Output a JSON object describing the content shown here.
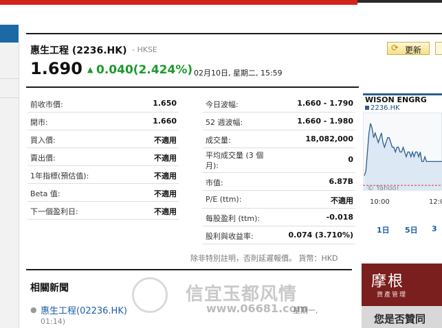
{
  "stock": {
    "name": "惠生工程 (2236.HK)",
    "exchange": "- HKSE",
    "price": "1.690",
    "change": "0.040(2.424%)",
    "timestamp": "02月10日, 星期二, 15:59",
    "refresh_label": "更新"
  },
  "left_table": [
    {
      "label": "前收市價:",
      "value": "1.650"
    },
    {
      "label": "開市:",
      "value": "1.660"
    },
    {
      "label": "買入價:",
      "value": "不適用"
    },
    {
      "label": "賣出價:",
      "value": "不適用"
    },
    {
      "label": "1年指標(預估值):",
      "value": "不適用"
    },
    {
      "label": "Beta 值:",
      "value": "不適用"
    },
    {
      "label": "下一個盈利日:",
      "value": "不適用"
    }
  ],
  "right_table": [
    {
      "label": "今日波幅:",
      "value": "1.660 - 1.790"
    },
    {
      "label": "52 週波幅:",
      "value": "1.660 - 1.980"
    },
    {
      "label": "成交量:",
      "value": "18,082,000"
    },
    {
      "label": "平均成交量 (3 個月):",
      "value": "0"
    },
    {
      "label": "市值:",
      "value": "6.87B"
    },
    {
      "label": "P/E (ttm):",
      "value": "不適用"
    },
    {
      "label": "每股盈利 (ttm):",
      "value": "-0.018"
    },
    {
      "label": "股利與收益率:",
      "value": "0.074 (3.710%)"
    }
  ],
  "table_note": "除非特別註明，否則延遲報價。 貨幣：HKD",
  "news": {
    "title": "相關新聞",
    "item_link": "惠生工程(02236.HK)",
    "item_meta": "星期一,",
    "item_time": "01:14)"
  },
  "watermark": {
    "text": "信宜玉都风情",
    "url": "www.06681.com"
  },
  "chart": {
    "title": "WISON ENGRG",
    "symbol": "2236.HK",
    "attribution": "© Yahoo!",
    "x_ticks": [
      "10:00",
      "12:0"
    ],
    "ranges": [
      "1日",
      "5日",
      "3"
    ],
    "line_color": "#2c5d8f",
    "fill_color": "#dce8f4"
  },
  "chart_data": {
    "type": "area",
    "title": "WISON ENGRG",
    "x": [
      0,
      2,
      4,
      6,
      8,
      10,
      12,
      14,
      16,
      18,
      20,
      22,
      24,
      26,
      28,
      30,
      32,
      34,
      36,
      38,
      40,
      42,
      44,
      46,
      48,
      50,
      52,
      54,
      56,
      58,
      60,
      62,
      64,
      66,
      68,
      70,
      72,
      74,
      76,
      78,
      80,
      82,
      84,
      86,
      88,
      90,
      92,
      94,
      96,
      98,
      100
    ],
    "values": [
      1.67,
      1.68,
      1.72,
      1.76,
      1.78,
      1.77,
      1.75,
      1.76,
      1.75,
      1.74,
      1.75,
      1.76,
      1.74,
      1.73,
      1.74,
      1.75,
      1.75,
      1.74,
      1.73,
      1.73,
      1.72,
      1.73,
      1.73,
      1.72,
      1.72,
      1.73,
      1.72,
      1.71,
      1.72,
      1.72,
      1.71,
      1.72,
      1.71,
      1.72,
      1.72,
      1.71,
      1.72,
      1.7,
      1.7,
      1.71,
      1.7,
      1.7,
      1.7,
      1.7,
      1.7,
      1.7,
      1.7,
      1.7,
      1.7,
      1.7,
      1.7
    ],
    "ylim": [
      1.64,
      1.8
    ],
    "reference_line": 1.65,
    "grid": false
  }
}
